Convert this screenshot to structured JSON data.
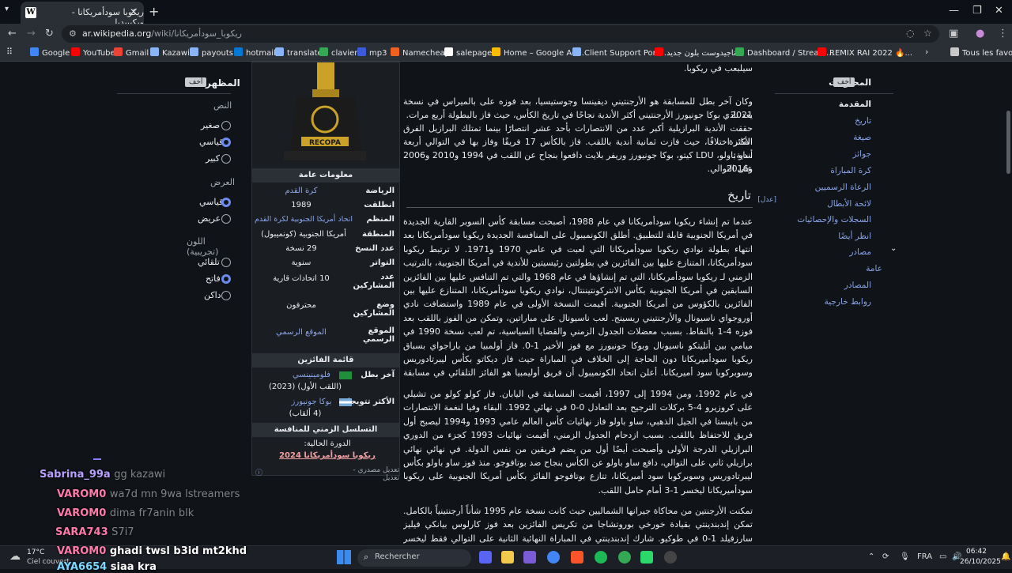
{
  "browser": {
    "tab_title": "ريكوبا سودأمريكانا - ويكيبيديا",
    "tab_favicon": "W",
    "url_domain": "ar.wikipedia.org",
    "url_path": "/wiki/ريكوبا_سودأمريكانا",
    "bookmarks": [
      {
        "label": "Google",
        "color": "#4285f4"
      },
      {
        "label": "YouTube",
        "color": "#ff0000"
      },
      {
        "label": "Gmail",
        "color": "#ea4335"
      },
      {
        "label": "Kazawi",
        "color": "#8ab4f8"
      },
      {
        "label": "payouts",
        "color": "#8ab4f8"
      },
      {
        "label": "hotmail",
        "color": "#0078d4"
      },
      {
        "label": "translate",
        "color": "#8ab4f8"
      },
      {
        "label": "clavier",
        "color": "#34a853"
      },
      {
        "label": "mp3",
        "color": "#3b5bdb"
      },
      {
        "label": "Namecheap",
        "color": "#f06020"
      },
      {
        "label": "salepage1",
        "color": "#ffffff"
      },
      {
        "label": "Home – Google Ad...",
        "color": "#fbbc04"
      },
      {
        "label": "Client Support Porta...",
        "color": "#8ab4f8"
      },
      {
        "label": "تاجيدوست بلون جديد...",
        "color": "#ff0000"
      },
      {
        "label": "Dashboard / Stream...",
        "color": "#34a853"
      },
      {
        "label": "REMIX RAI 2022 🔥...",
        "color": "#ff0000"
      }
    ],
    "all_bookmarks": "Tous les favoris"
  },
  "appearance": {
    "title": "المظهر",
    "hide": "أخف",
    "text_section": "النص",
    "text_options": [
      "صغير",
      "قياسي",
      "كبير"
    ],
    "width_section": "العرض",
    "width_options": [
      "قياسي",
      "عريض"
    ],
    "color_section": "اللون (تجريبية)",
    "color_options": [
      "تلقائي",
      "فاتح",
      "داكن"
    ]
  },
  "infobox": {
    "trophy_text": "RECOPA",
    "general_header": "معلومات عامة",
    "rows": [
      {
        "label": "الرياضة",
        "value": "كرة القدم",
        "link": true
      },
      {
        "label": "انطلقت",
        "value": "1989",
        "link": false
      },
      {
        "label": "المنظم",
        "value": "اتحاد أمريكا الجنوبية لكرة القدم",
        "link": true
      },
      {
        "label": "المنطقة",
        "value": "أمريكا الجنوبية (كونميبول)",
        "link": false
      },
      {
        "label": "عدد النسخ",
        "value": "29 نسخة",
        "link": false
      },
      {
        "label": "التواتر",
        "value": "سنوية",
        "link": false
      },
      {
        "label": "عدد المشاركين",
        "value": "10 اتحادات قارية",
        "link": false
      },
      {
        "label": "وضع المشاركين",
        "value": "محترفون",
        "link": false
      },
      {
        "label": "الموقع الرسمي",
        "value": "الموقع الرسمي",
        "link": true
      }
    ],
    "winners_header": "قائمة الفائزين",
    "last_winner_label": "آخر بطل",
    "last_winner": "فلومينينسي",
    "last_winner_note": "(اللقب الأول) (2023)",
    "most_wins_label": "الأكثر تتويجا",
    "most_wins": "بوكا جونيورز",
    "most_wins_note": "(4 ألقاب)",
    "timeline_header": "التسلسل الزمني للمنافسة",
    "current_label": "الدورة الحالية:",
    "current": "ريكوبا سودأمريكانا 2024",
    "edit_links": "تعديل مصدري - تعديل"
  },
  "article": {
    "intro_lines": [
      "سيلبعب في ريكوبا.",
      "وكان آخر بطل للمسابقة هو الأرجنتيني ديفينسا وجوستيسيا، بعد فوزه على بالميراس في نسخة 2021 .",
      "يعد نادي بوكا جونيورز الأرجنتيني أكثر الأندية نجاحًا في تاريخ الكأس، حيث فاز بالبطولة أربع مرات.",
      "حققت الأندية البرازيلية أكبر عدد من الانتصارات بأحد عشر انتصارًا بينما تمتلك البرازيل الفرق الفائزة",
      "الأكثر اختلافًا، حيث فازت ثمانية أندية باللقب. فاز بالكأس 17 فريقًا وفاز بها في التوالي أربعة أندية:",
      "ساو باولو، LDU كيتو، بوكا جونيورز وريفر بلايت دافعوا بنجاح عن اللقب في 1994 و2010 و2006 و2016",
      "على التوالي."
    ],
    "history_heading": "تاريخ",
    "edit": "[عدل]",
    "para1": "عندما تم إنشاء ريكوبا سودأمريكانا في عام 1988، أصبحت مسابقة كأس السوبر القارية الجديدة في أمريكا الجنوبية قابلة للتطبيق. أطلق الكونميبول على المنافسة الجديدة ريكوبا سودأمريكانا بعد انتهاء بطولة نوادي ريكوبا سودأمريكانا التي لعبت في عامي 1970 و1971. لا ترتبط ريكوبا سودأمريكانا، المتنازع عليها بين الفائزين في بطولتين رئيسيتين للأندية في أمريكا الجنوبية، بالترتيب الزمني لـ ريكوبا سودأمريكانا، التي تم إنشاؤها في عام 1968 والتي تم التنافس عليها بين الفائزين السابقين في أمريكا الجنوبية بكأس الانتركونتيننتال، نوادي ريكوبا سودأمريكانا، المتنازع عليها بين الفائزين بالكؤوس من أمريكا الجنوبية. أقيمت النسخة الأولى في عام 1989 واستضافت نادي أوروجواي ناسيونال والأرجنتيني ريسينج. لعب ناسيونال على مباراتين، وتمكن من الفوز باللقب بعد فوزه 4-1 بالنقاط. بسبب معضلات الجدول الزمني والقضايا السياسية، تم لعب نسخة 1990 في ميامي بين أتليتكو ناسيونال وبوكا جونيورز مع فوز الأخير 1-0. فاز أولمبيا من باراجواي بسباق ريكوبا سودأميريكانا دون الحاجة إلى الخلاف في المباراة حيث فاز ديكاتو بكأس ليبرتادوريس وسوبركوبا سود أميريكانا. أعلن اتحاد الكونميبول أن فريق أوليمبيا هو الفائز التلقائي في مسابقة عام 1991.",
    "para2": "في عام 1992، ومن 1994 إلى 1997، أقيمت المسابقة في اليابان. فاز كولو كولو من تشيلي على كروزيرو 4-5 بركلات الترجيح بعد التعادل 0-0 في نهائي 1992. البقاء وفيا لنغمة الانتصارات من بابيستا في الجيل الذهبي، ساو باولو فاز نهائيات كأس العالم عامي 1993 و1994 ليصبح أول فريق للاحتفاظ باللقب. بسبب ازدحام الجدول الزمني، أقيمت نهائيات 1993 كجزء من الدوري البرازيلي الدرجة الأولى وأصبحت أيضًا أول من يضم فريقين من نفس الدولة. في نهائي نهائي برازيلي ثاني على التوالي، دافع ساو باولو عن الكأس بنجاح ضد بوتافوجو. منذ فوز ساو باولو بكأس ليبرتادوريس وسوبركوبا سود أميريكانا، تتازع بوتافوجو الفائز بكأس أمريكا الجنوبية على ريكوبا سودأميريكانا ليخسر 1-3 أمام حامل اللقب.",
    "para3": "تمكنت الأرجنتين من محاكاة جيرانها الشماليين حيث كانت نسخة عام 1995 شأناً أرجنتينياً بالكامل. تمكن إندبندينتي بقيادة خورخي بوروتشاجا من تكريس الفائزين بعد فوز كارلوس بيانكي فيليز سارزفيلد 1-0 في طوكيو. شارك إندبندينتي في المباراة النهائية الثانية على التوالي فقط ليخسر اللقب أمام غريميو بورتو أليغرينز بعد هزيمته 4-1. فاز فريق فيليز سارسفيلد بإصدار 1997 الذي تم خرج من دائرة الضوء الأول بلقبه"
  },
  "toc": {
    "title": "المحتويات",
    "hide": "أخف",
    "items": [
      {
        "label": "المقدمة",
        "bold": true
      },
      {
        "label": "تاريخ",
        "bold": false
      },
      {
        "label": "صيغة",
        "bold": false
      },
      {
        "label": "جوائز",
        "bold": false
      },
      {
        "label": "كرة المباراة",
        "bold": false
      },
      {
        "label": "الرعاة الرسميين",
        "bold": false
      },
      {
        "label": "لائحة الأبطال",
        "bold": false
      },
      {
        "label": "السجلات والإحصائيات",
        "bold": false
      },
      {
        "label": "انظر أيضًا",
        "bold": false
      },
      {
        "label": "مصادر",
        "bold": false
      },
      {
        "label": "عامة",
        "bold": false
      },
      {
        "label": "المصادر",
        "bold": false
      },
      {
        "label": "روابط خارجية",
        "bold": false
      }
    ]
  },
  "chat": [
    {
      "user": "Sabrina_99a",
      "msg": "gg kazawi",
      "color": "#b9a0ff"
    },
    {
      "user": "VAROM0",
      "msg": "wa7d mn 9wa lstreamers",
      "color": "#ff7aa8"
    },
    {
      "user": "VAROM0",
      "msg": "dima fr7anin blk",
      "color": "#ff7aa8"
    },
    {
      "user": "SARA743",
      "msg": "S7i7",
      "color": "#ff7aa8"
    },
    {
      "user": "VAROM0",
      "msg": "ghadi twsl b3id mt2khd",
      "color": "#ff7aa8"
    },
    {
      "user": "AYA6654",
      "msg": "siaa kra",
      "color": "#7ad7ff"
    }
  ],
  "taskbar": {
    "weather_temp": "17°C",
    "weather_desc": "Ciel couvert",
    "search_placeholder": "Rechercher",
    "lang": "FRA",
    "time": "06:42",
    "date": "26/10/2025"
  }
}
